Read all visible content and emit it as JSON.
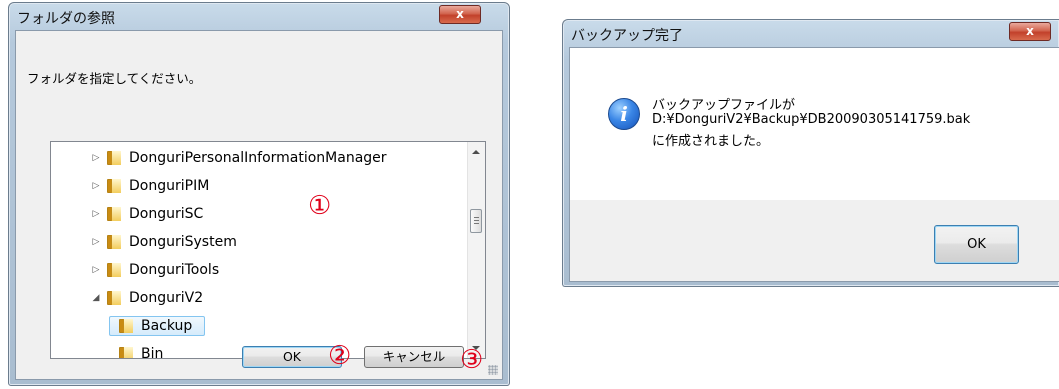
{
  "folder_dialog": {
    "title": "フォルダの参照",
    "close_label": "x",
    "instruction": "フォルダを指定してください。",
    "tree_items": [
      {
        "label": "DonguriPersonalInformationManager",
        "expander": "▷"
      },
      {
        "label": "DonguriPIM",
        "expander": "▷"
      },
      {
        "label": "DonguriSC",
        "expander": "▷"
      },
      {
        "label": "DonguriSystem",
        "expander": "▷"
      },
      {
        "label": "DonguriTools",
        "expander": "▷"
      },
      {
        "label": "DonguriV2",
        "expander": "◢"
      },
      {
        "label": "Backup",
        "expander": "",
        "selected": true
      },
      {
        "label": "Bin",
        "expander": ""
      }
    ],
    "ok_label": "OK",
    "cancel_label": "キャンセル",
    "markers": {
      "one": "①",
      "two": "②",
      "three": "③"
    },
    "marker_color": "#e0001a"
  },
  "backup_dialog": {
    "title": "バックアップ完了",
    "close_label": "x",
    "message_lines": [
      "バックアップファイルが",
      "D:¥DonguriV2¥Backup¥DB20090305141759.bak",
      "に作成されました。"
    ],
    "icon": "info-icon",
    "icon_glyph": "i",
    "ok_label": "OK"
  }
}
